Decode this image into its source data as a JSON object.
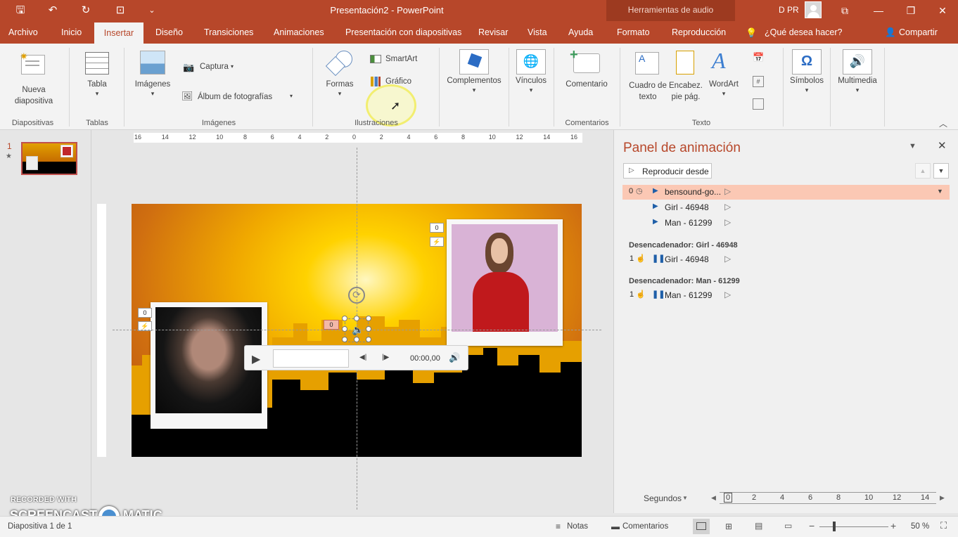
{
  "titlebar": {
    "doc_title": "Presentación2 - PowerPoint",
    "context_tools": "Herramientas de audio",
    "user": "D PR"
  },
  "tabs": [
    "Archivo",
    "Inicio",
    "Insertar",
    "Diseño",
    "Transiciones",
    "Animaciones",
    "Presentación con diapositivas",
    "Revisar",
    "Vista",
    "Ayuda",
    "Formato",
    "Reproducción"
  ],
  "tell_me": "¿Qué desea hacer?",
  "share": "Compartir",
  "ribbon": {
    "nueva_diapositiva": "Nueva diapositiva",
    "tabla": "Tabla",
    "imagenes": "Imágenes",
    "captura": "Captura",
    "album": "Álbum de fotografías",
    "formas": "Formas",
    "smartart": "SmartArt",
    "grafico": "Gráfico",
    "complementos": "Complementos",
    "vinculos": "Vínculos",
    "comentario": "Comentario",
    "cuadro_texto": "Cuadro de texto",
    "encabez": "Encabez. pie pág.",
    "wordart": "WordArt",
    "simbolos": "Símbolos",
    "multimedia": "Multimedia",
    "groups": {
      "diapositivas": "Diapositivas",
      "tablas": "Tablas",
      "imagenes": "Imágenes",
      "ilustraciones": "Ilustraciones",
      "comentarios": "Comentarios",
      "texto": "Texto"
    }
  },
  "thumbnail": {
    "number": "1",
    "star": "★"
  },
  "slide": {
    "media_time": "00:00,00",
    "tag_girl": "0",
    "tag_man": "0",
    "tag_audio": "0"
  },
  "ruler_labels": [
    "16",
    "14",
    "12",
    "10",
    "8",
    "6",
    "4",
    "2",
    "0",
    "2",
    "4",
    "6",
    "8",
    "10",
    "12",
    "14",
    "16"
  ],
  "anim_panel": {
    "title": "Panel de animación",
    "play_from": "Reproducir desde",
    "items": [
      {
        "num": "0",
        "name": "bensound-go..."
      },
      {
        "num": "",
        "name": "Girl - 46948"
      },
      {
        "num": "",
        "name": "Man - 61299"
      }
    ],
    "trigger1": {
      "label": "Desencadenador: Girl - 46948",
      "num": "1",
      "name": "Girl - 46948"
    },
    "trigger2": {
      "label": "Desencadenador: Man - 61299",
      "num": "1",
      "name": "Man - 61299"
    },
    "seconds": "Segundos",
    "timeline": [
      "0",
      "2",
      "4",
      "6",
      "8",
      "10",
      "12",
      "14"
    ]
  },
  "statusbar": {
    "slide_info": "Diapositiva 1 de 1",
    "notes": "Notas",
    "comments": "Comentarios",
    "zoom": "50 %"
  },
  "watermark": {
    "line1": "RECORDED WITH",
    "line2": "SCREENCAST",
    "line3": "MATIC"
  }
}
